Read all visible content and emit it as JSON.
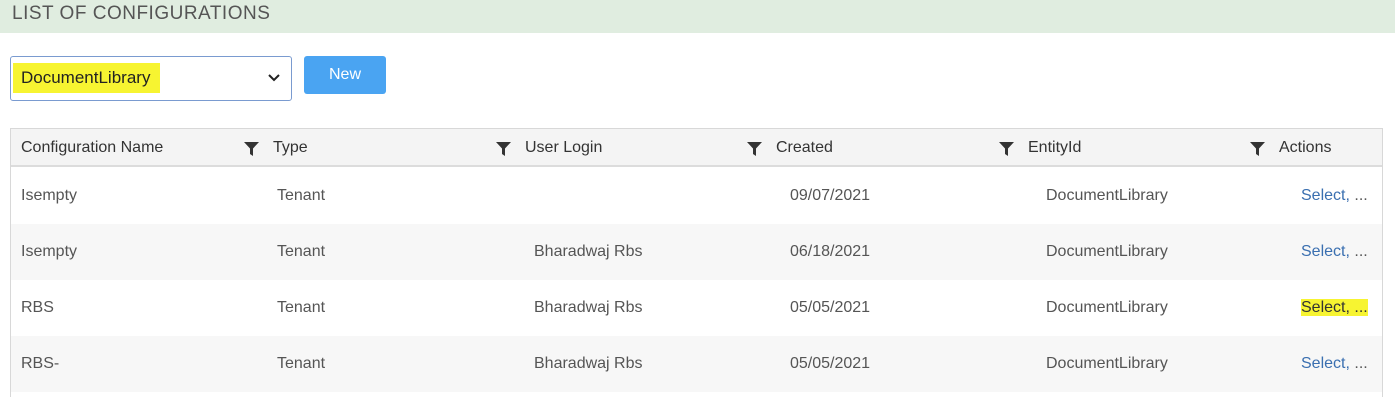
{
  "page": {
    "title": "LIST OF CONFIGURATIONS"
  },
  "toolbar": {
    "selected_library": "DocumentLibrary",
    "new_label": "New"
  },
  "colors": {
    "header_band": "#e0ede0",
    "new_button": "#4aa4f2",
    "highlight": "#f7f431",
    "link": "#3a6fb0"
  },
  "table": {
    "columns": [
      "Configuration Name",
      "Type",
      "User Login",
      "Created",
      "EntityId",
      "Actions"
    ],
    "rows": [
      {
        "name": "Isempty",
        "type": "Tenant",
        "user": "",
        "created": "09/07/2021",
        "entity": "DocumentLibrary",
        "action_link": "Select,",
        "action_more": " ..."
      },
      {
        "name": "Isempty",
        "type": "Tenant",
        "user": "Bharadwaj Rbs",
        "created": "06/18/2021",
        "entity": "DocumentLibrary",
        "action_link": "Select,",
        "action_more": " ..."
      },
      {
        "name": "RBS",
        "type": "Tenant",
        "user": "Bharadwaj Rbs",
        "created": "05/05/2021",
        "entity": "DocumentLibrary",
        "action_link": "Select,",
        "action_more": " ..."
      },
      {
        "name": "RBS-",
        "type": "Tenant",
        "user": "Bharadwaj Rbs",
        "created": "05/05/2021",
        "entity": "DocumentLibrary",
        "action_link": "Select,",
        "action_more": " ..."
      }
    ]
  }
}
